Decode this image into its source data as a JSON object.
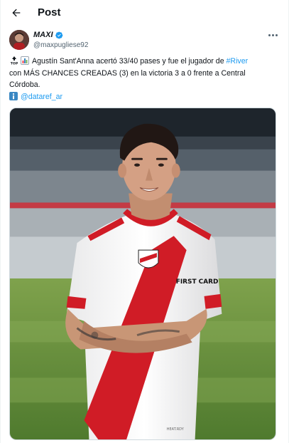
{
  "header": {
    "title": "Post"
  },
  "author": {
    "name": "MAXI",
    "handle": "@maxpugliese92",
    "verified": true
  },
  "tweet": {
    "line1_prefix": "Agustín Sant'Anna acertó 33/40 pases y fue el jugador de ",
    "hashtag": "#River",
    "line2": "con MÁS CHANCES CREADAS (3) en la victoria 3 a 0 frente a Central",
    "line3": "Córdoba.",
    "mention": "@dataref_ar"
  },
  "media": {
    "sponsor_text": "FIRST CARD",
    "brand_text": "HEAT.RDY"
  },
  "colors": {
    "accent": "#1d9bf0",
    "secondary_text": "#536471",
    "jersey_red": "#d01c26"
  }
}
